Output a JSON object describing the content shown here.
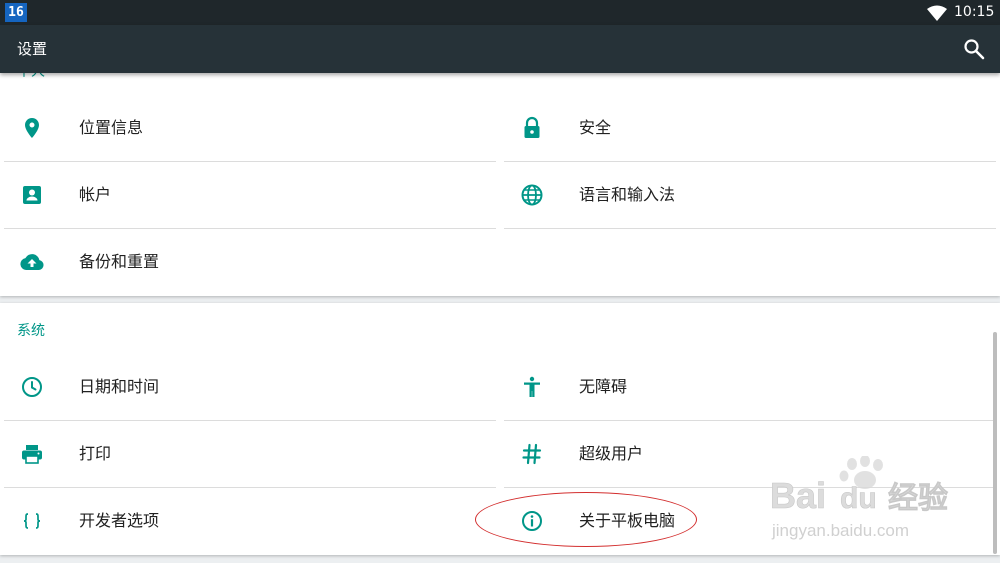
{
  "status_bar": {
    "badge": "16",
    "time": "10:15"
  },
  "toolbar": {
    "title": "设置"
  },
  "sections": {
    "personal": {
      "title": "个人",
      "items": [
        {
          "label": "位置信息",
          "icon": "location-icon"
        },
        {
          "label": "安全",
          "icon": "lock-icon"
        },
        {
          "label": "帐户",
          "icon": "account-icon"
        },
        {
          "label": "语言和输入法",
          "icon": "globe-icon"
        },
        {
          "label": "备份和重置",
          "icon": "cloud-upload-icon"
        }
      ]
    },
    "system": {
      "title": "系统",
      "items": [
        {
          "label": "日期和时间",
          "icon": "clock-icon"
        },
        {
          "label": "无障碍",
          "icon": "accessibility-icon"
        },
        {
          "label": "打印",
          "icon": "printer-icon"
        },
        {
          "label": "超级用户",
          "icon": "hash-icon"
        },
        {
          "label": "开发者选项",
          "icon": "braces-icon"
        },
        {
          "label": "关于平板电脑",
          "icon": "info-icon"
        }
      ]
    }
  },
  "watermark": {
    "brand_a": "Bai",
    "brand_b": "du",
    "brand_c": "经验",
    "url": "jingyan.baidu.com"
  },
  "colors": {
    "accent": "#009688",
    "toolbar": "#263238",
    "status_bar": "#1f272b",
    "highlight": "#d32f2f"
  }
}
